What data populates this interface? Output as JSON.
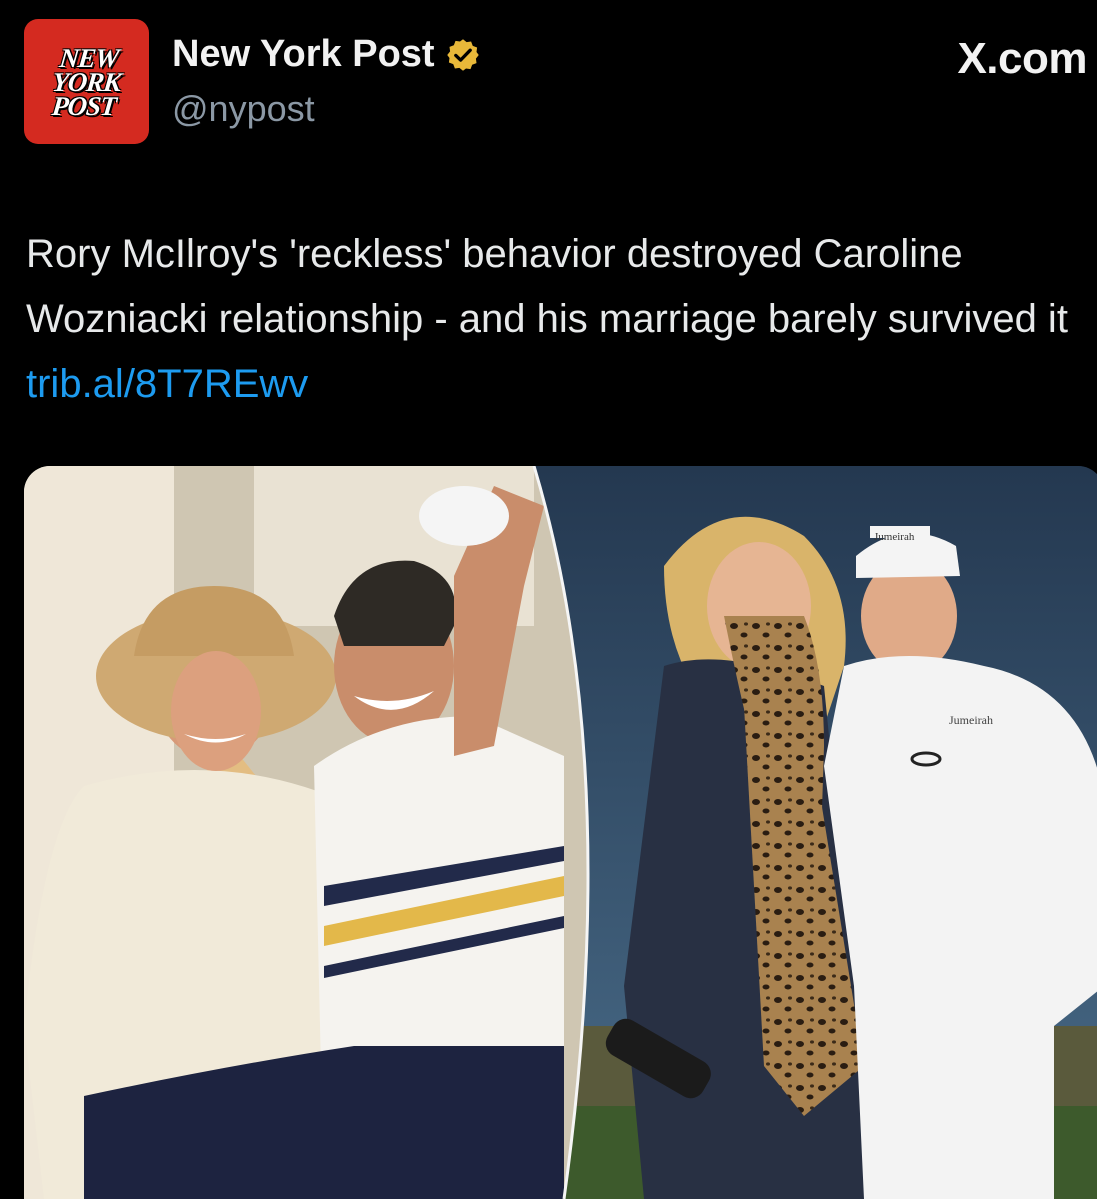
{
  "account": {
    "avatar_logo_lines": [
      "NEW",
      "YORK",
      "POST"
    ],
    "display_name": "New York Post",
    "handle": "@nypost",
    "verified_badge": "gold-verified-badge-icon",
    "avatar_color": "#d42a20"
  },
  "source": "X.com",
  "tweet": {
    "text": "Rory McIlroy's 'reckless' behavior destroyed Caroline Wozniacki relationship - and his marriage barely survived it ",
    "link": "trib.al/8T7REwv",
    "link_color": "#1d9bf0"
  },
  "media": {
    "photo_caps_text": [
      "Jumeirah",
      "Jumeirah"
    ]
  }
}
